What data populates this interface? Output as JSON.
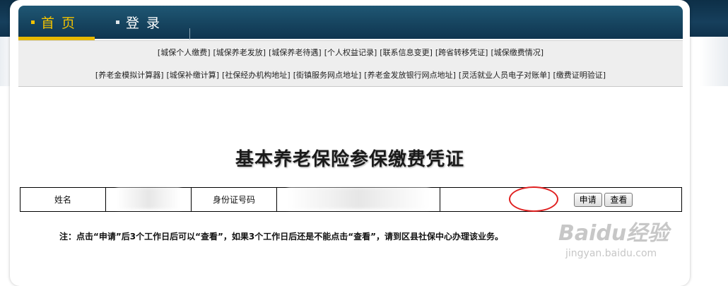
{
  "nav": {
    "tabs": [
      {
        "label": "首页",
        "active": true
      },
      {
        "label": "登录",
        "active": false
      }
    ]
  },
  "links_row1": [
    "[城保个人缴费]",
    "[城保养老发放]",
    "[城保养老待遇]",
    "[个人权益记录]",
    "[联系信息变更]",
    "[跨省转移凭证]",
    "[城保缴费情况]"
  ],
  "links_row2": [
    "[养老金模拟计算器]",
    "[城保补缴计算]",
    "[社保经办机构地址]",
    "[街镇服务网点地址]",
    "[养老金发放银行网点地址]",
    "[灵活就业人员电子对账单]",
    "[缴费证明验证]"
  ],
  "page": {
    "title": "基本养老保险参保缴费凭证"
  },
  "info_table": {
    "name_label": "姓名",
    "id_label": "身份证号码",
    "apply_button": "申请",
    "view_button": "查看"
  },
  "note": "注：点击“申请”后3个工作日后可以“查看”，如果3个工作日后还是不能点击“查看”，请到区县社保中心办理该业务。",
  "watermark": {
    "logo": "Baidu经验",
    "url": "jingyan.baidu.com"
  },
  "colors": {
    "nav_bg": "#16445f",
    "active_tab": "#f2c200",
    "highlight_circle": "#e02020"
  }
}
